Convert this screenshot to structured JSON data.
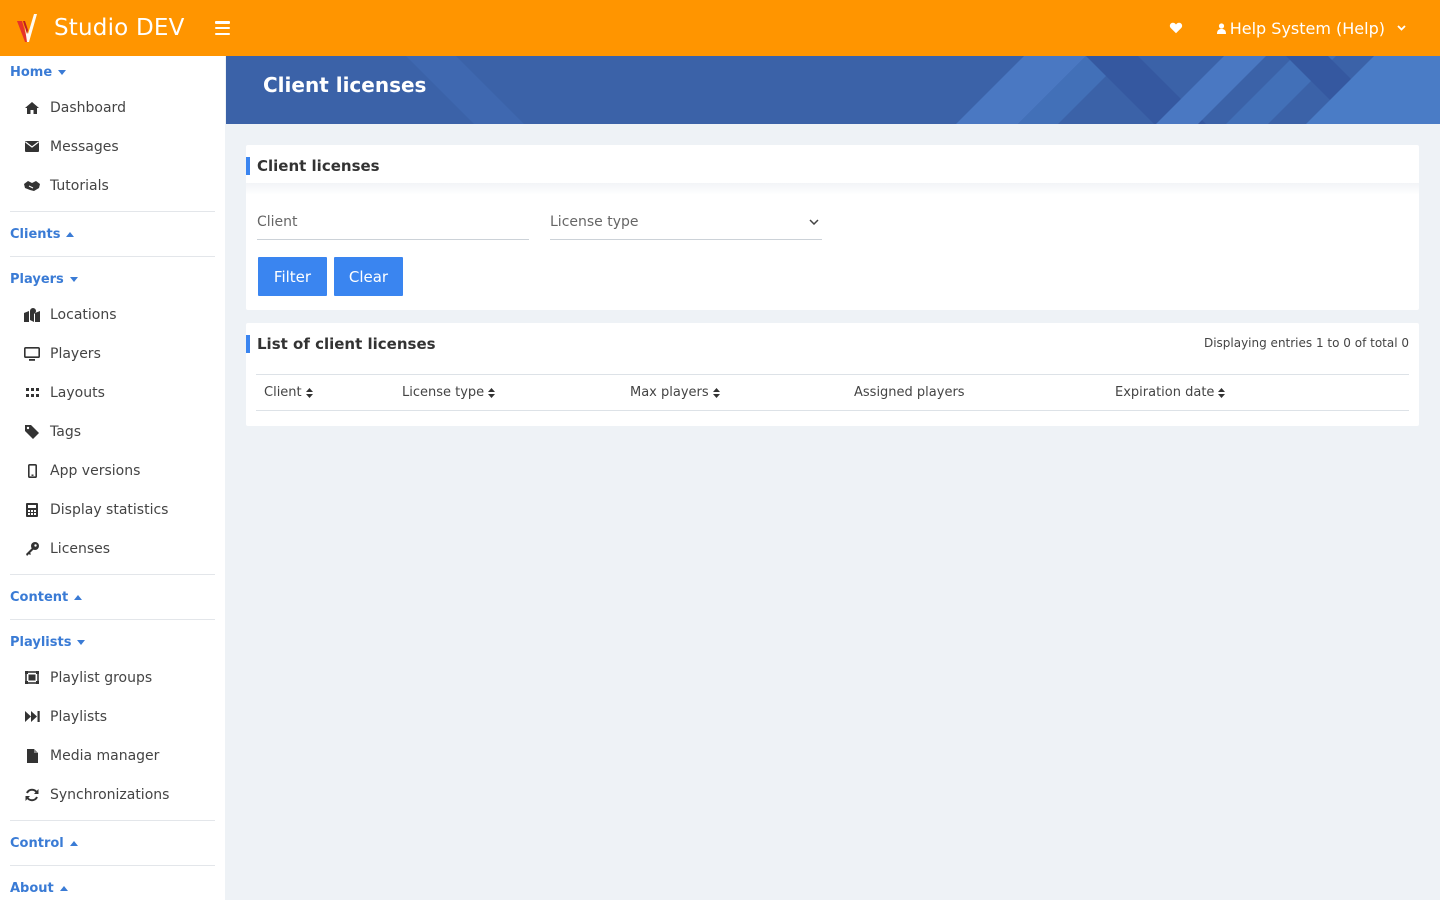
{
  "app": {
    "title": "Studio DEV",
    "user": "Help System (Help)",
    "accent": "#ff9500",
    "primary": "#3a85f0",
    "banner_color": "#3b62a8"
  },
  "sidebar": {
    "home": {
      "label": "Home",
      "items": [
        "Dashboard",
        "Messages",
        "Tutorials"
      ]
    },
    "clients": {
      "label": "Clients"
    },
    "players": {
      "label": "Players",
      "items": [
        "Locations",
        "Players",
        "Layouts",
        "Tags",
        "App versions",
        "Display statistics",
        "Licenses"
      ]
    },
    "content": {
      "label": "Content"
    },
    "playlists": {
      "label": "Playlists",
      "items": [
        "Playlist groups",
        "Playlists",
        "Media manager",
        "Synchronizations"
      ]
    },
    "control": {
      "label": "Control"
    },
    "about": {
      "label": "About"
    }
  },
  "page": {
    "title": "Client licenses"
  },
  "filter": {
    "title": "Client licenses",
    "client_placeholder": "Client",
    "license_type_label": "License type",
    "filter_label": "Filter",
    "clear_label": "Clear"
  },
  "list": {
    "title": "List of client licenses",
    "info": "Displaying entries 1 to 0 of total 0",
    "columns": [
      "Client",
      "License type",
      "Max players",
      "Assigned players",
      "Expiration date"
    ]
  }
}
